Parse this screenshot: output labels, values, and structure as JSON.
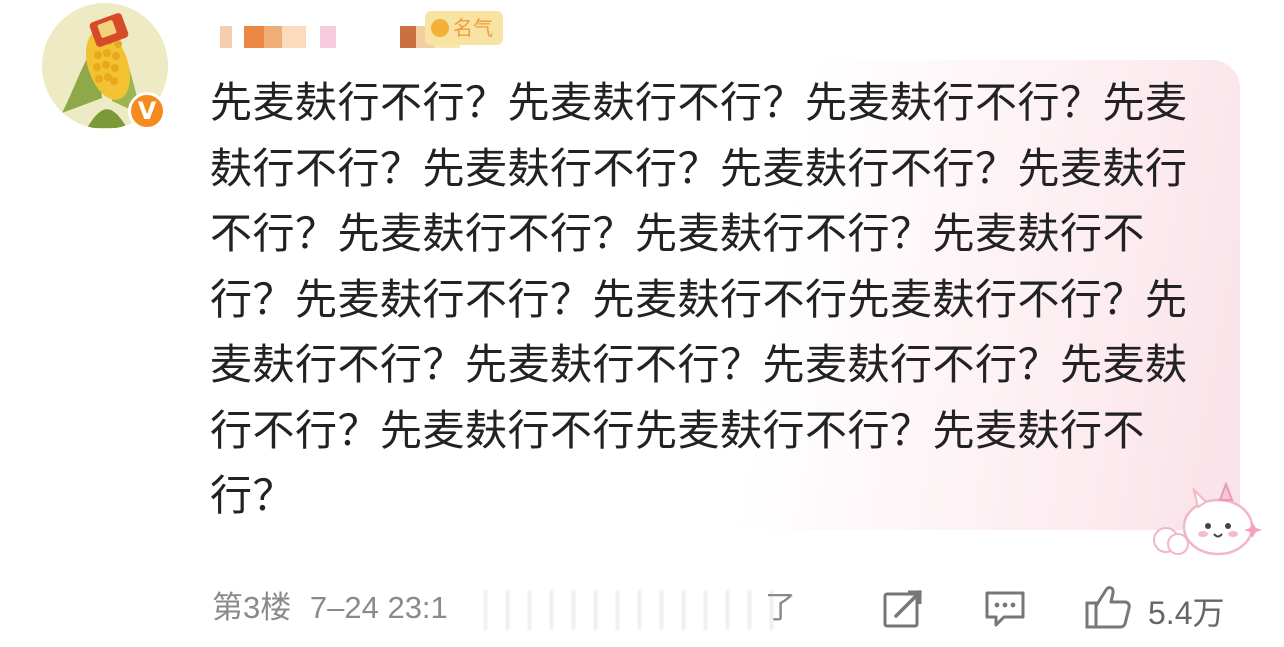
{
  "comment": {
    "author": {
      "avatar_icon": "corn-avatar",
      "verified_badge": "V",
      "name": "██████",
      "tag_label": "名气"
    },
    "text": "先麦麸行不行？先麦麸行不行？先麦麸行不行？先麦麸行不行？先麦麸行不行？先麦麸行不行？先麦麸行不行？先麦麸行不行？先麦麸行不行？先麦麸行不行？先麦麸行不行？先麦麸行不行先麦麸行不行？先麦麸行不行？先麦麸行不行？先麦麸行不行？先麦麸行不行？先麦麸行不行先麦麸行不行？先麦麸行不行？",
    "floor": "第3楼",
    "timestamp": "7–24 23:1",
    "location_suffix": "了",
    "actions": {
      "share_icon": "share-icon",
      "reply_icon": "comment-icon",
      "like_icon": "thumbs-up-icon",
      "like_count": "5.4万"
    }
  },
  "colors": {
    "bubble_tint": "#f9e1e8",
    "tag_bg": "#f7e4a3",
    "tag_text": "#f29b3d",
    "verified": "#f58b1f",
    "footer_text": "#8a8a8a"
  }
}
